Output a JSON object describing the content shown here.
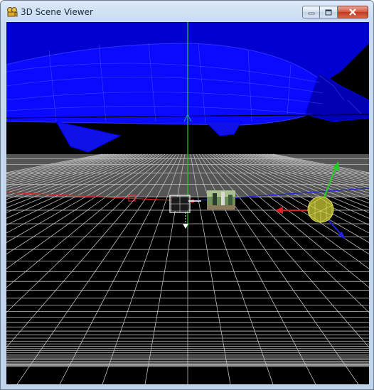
{
  "window": {
    "title": "3D Scene Viewer",
    "controls": {
      "minimize": "minimize",
      "maximize": "maximize",
      "close": "close"
    }
  },
  "viewport": {
    "background": "#000000",
    "floor_color": "#555555",
    "grid_color": "#bfbfbf",
    "axis_colors": {
      "x": "#e02020",
      "y": "#20d020",
      "z": "#2020e0"
    },
    "objects": [
      {
        "name": "airplane-wireframe",
        "color": "#0000ff"
      },
      {
        "name": "camera-cube-gizmo",
        "color": "#ffffff"
      },
      {
        "name": "image-plane",
        "color": "#7aa36a"
      },
      {
        "name": "geodesic-sphere",
        "color": "#c8c83a"
      }
    ]
  }
}
